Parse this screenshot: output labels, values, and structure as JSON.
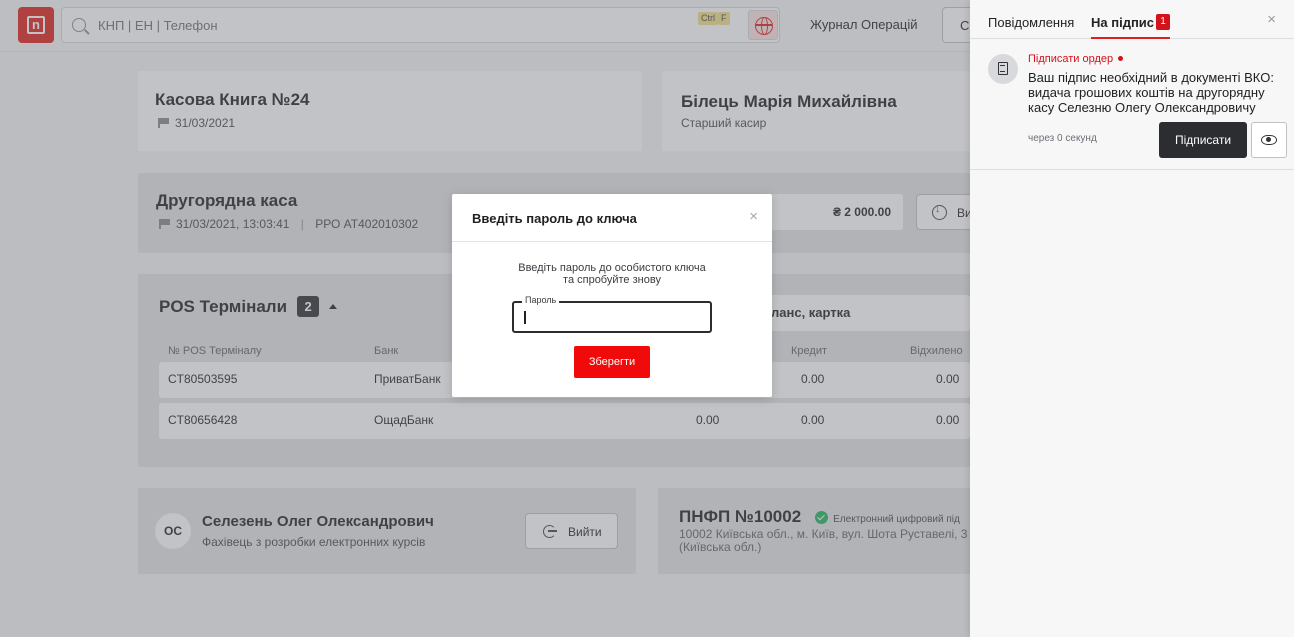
{
  "colors": {
    "accent": "#e0201a",
    "dark": "#2b2d31",
    "badge": "#d4121a",
    "success": "#21b35c"
  },
  "topbar": {
    "logo_text": "n",
    "search_placeholder": "КНП | ЕН | Телефон",
    "hotkey_1": "Ctrl",
    "hotkey_2": "F",
    "journal_label": "Журнал Операцій",
    "button_label": "С"
  },
  "cashbook": {
    "title": "Касова Книга №24",
    "date": "31/03/2021"
  },
  "cashier": {
    "name": "Білець Марія Михайлівна",
    "role": "Старший касир"
  },
  "secondary_cash": {
    "title": "Другорядна каса",
    "datetime": "31/03/2021, 13:03:41",
    "separator": "|",
    "rro": "РРО AT402010302",
    "amount": "₴ 2 000.00",
    "button_label": "Ви"
  },
  "pos": {
    "title": "POS Термінали",
    "count": "2",
    "balance_label": "ланс, картка",
    "columns": {
      "terminal": "№ POS Терміналу",
      "bank": "Банк",
      "credit": "Кредит",
      "declined": "Відхилено"
    },
    "rows": [
      {
        "terminal": "CT80503595",
        "bank": "ПриватБанк",
        "amount": "",
        "credit": "0.00",
        "declined": "0.00"
      },
      {
        "terminal": "CT80656428",
        "bank": "ОщадБанк",
        "amount": "0.00",
        "credit": "0.00",
        "declined": "0.00"
      }
    ]
  },
  "user": {
    "initials": "ОС",
    "name": "Селезень Олег Олександрович",
    "role": "Фахівець з розробки електронних курсів",
    "exit_label": "Вийти"
  },
  "pnfp": {
    "title": "ПНФП №10002",
    "signature_status": "Електронний цифровий під",
    "address_line1": "10002 Київська обл., м. Київ, вул. Шота Руставелі, 3",
    "address_line2": "(Київська обл.)"
  },
  "modal": {
    "title": "Введіть пароль до ключа",
    "close": "×",
    "message_line1": "Введіть пароль до особистого ключа",
    "message_line2": "та спробуйте знову",
    "password_label": "Пароль",
    "save_label": "Зберегти"
  },
  "panel": {
    "tab_messages": "Повідомлення",
    "tab_to_sign": "На підпис",
    "to_sign_count": "1",
    "close": "×",
    "notification": {
      "type": "Підписати ордер",
      "text": "Ваш підпис необхідний в документі ВКО: видача грошових коштів на другорядну касу Селезню Олегу Олександровичу",
      "time": "через 0 секунд",
      "sign_label": "Підписати"
    }
  }
}
